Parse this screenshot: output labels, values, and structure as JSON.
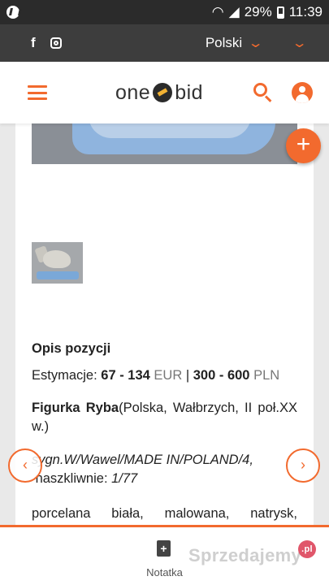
{
  "status_bar": {
    "battery_percent": "29%",
    "time": "11:39"
  },
  "top_bar": {
    "language": "Polski",
    "facebook_icon": "f",
    "instagram_icon": "instagram-icon",
    "chevron": "⌄"
  },
  "header": {
    "logo_left": "one",
    "logo_right": "bid"
  },
  "item": {
    "section_title": "Opis pozycji",
    "estimate_label": "Estymacje:",
    "estimate_eur": "67 - 134",
    "currency_eur": "EUR",
    "separator": "|",
    "estimate_pln": "300 - 600",
    "currency_pln": "PLN",
    "desc_title": "Figurka Ryba",
    "desc_origin": "(Polska, Wałbrzych, II poł.XX w.)",
    "desc_mark": "sygn.W/Wawel/MADE IN/POLAND/4,",
    "desc_glaze_label": " naszkliwnie: ",
    "desc_glaze_value": "1/77",
    "desc_material": "porcelana biała, malowana, natrysk,"
  },
  "buttons": {
    "fab_plus": "+",
    "prev": "‹",
    "next": "›"
  },
  "bottom_bar": {
    "note_label": "Notatka",
    "note_icon_glyph": "+"
  },
  "watermark": {
    "text": "Sprzedajemy",
    "badge": ".pl"
  },
  "colors": {
    "accent": "#f26a2e",
    "topbar": "#3d3d3d",
    "statusbar": "#2b2b2b"
  }
}
